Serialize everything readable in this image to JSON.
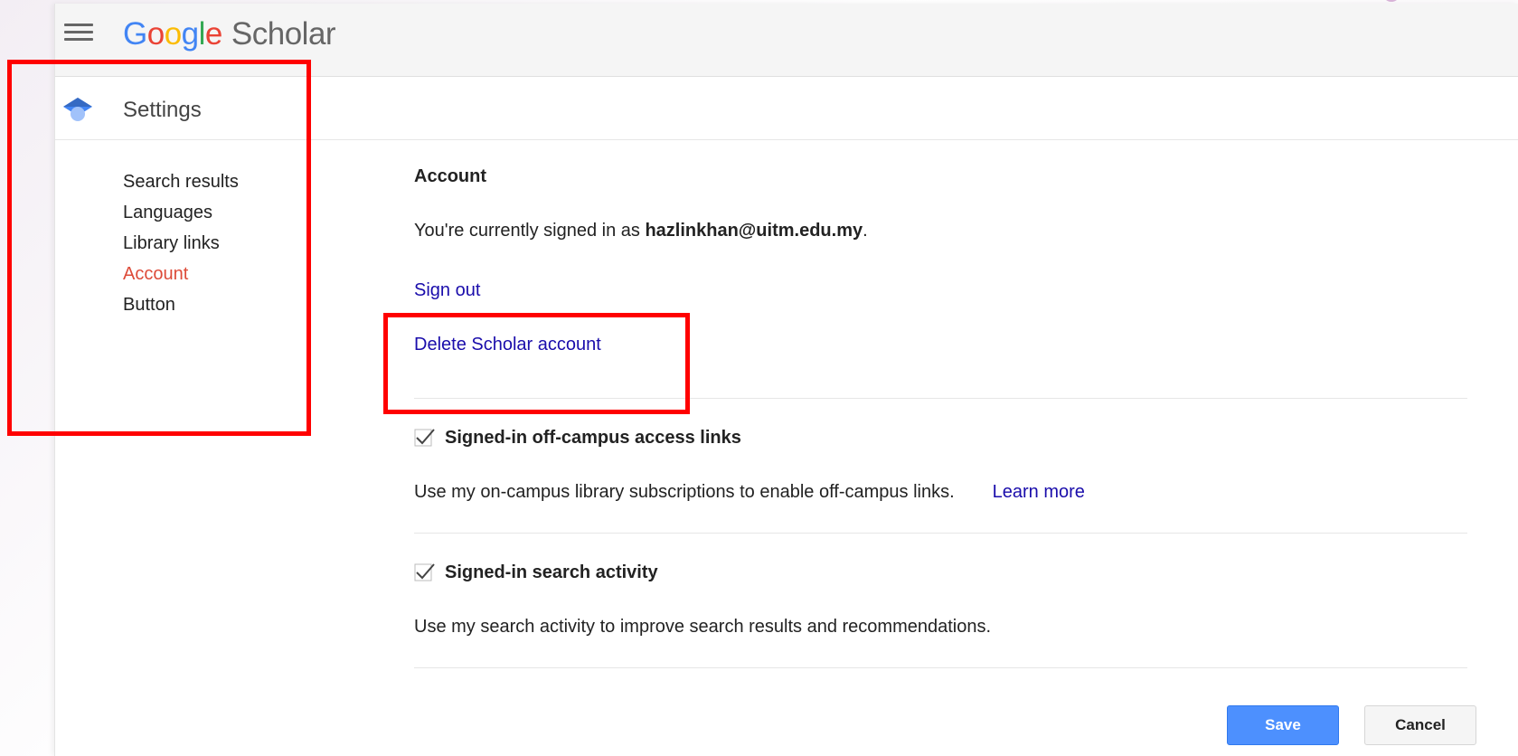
{
  "header": {
    "logo_letters": [
      "G",
      "o",
      "o",
      "g",
      "l",
      "e"
    ],
    "logo_product": "Scholar",
    "menu_icon": "hamburger-menu-icon"
  },
  "settings_bar": {
    "icon": "graduation-cap-icon",
    "title": "Settings"
  },
  "sidebar": {
    "items": [
      {
        "label": "Search results",
        "active": false
      },
      {
        "label": "Languages",
        "active": false
      },
      {
        "label": "Library links",
        "active": false
      },
      {
        "label": "Account",
        "active": true
      },
      {
        "label": "Button",
        "active": false
      }
    ]
  },
  "account": {
    "section_title": "Account",
    "signed_in_prefix": "You're currently signed in as ",
    "email": "hazlinkhan@uitm.edu.my",
    "signed_in_suffix": ".",
    "sign_out": "Sign out",
    "delete_account": "Delete Scholar account"
  },
  "off_campus": {
    "checked": true,
    "label": "Signed-in off-campus access links",
    "description": "Use my on-campus library subscriptions to enable off-campus links.",
    "learn_more": "Learn more"
  },
  "search_activity": {
    "checked": true,
    "label": "Signed-in search activity",
    "description": "Use my search activity to improve search results and recommendations."
  },
  "buttons": {
    "save": "Save",
    "cancel": "Cancel"
  },
  "colors": {
    "active_nav": "#dd4b39",
    "link": "#1a0dab",
    "save_button": "#4d90fe",
    "annotation_box": "#ff0000"
  }
}
